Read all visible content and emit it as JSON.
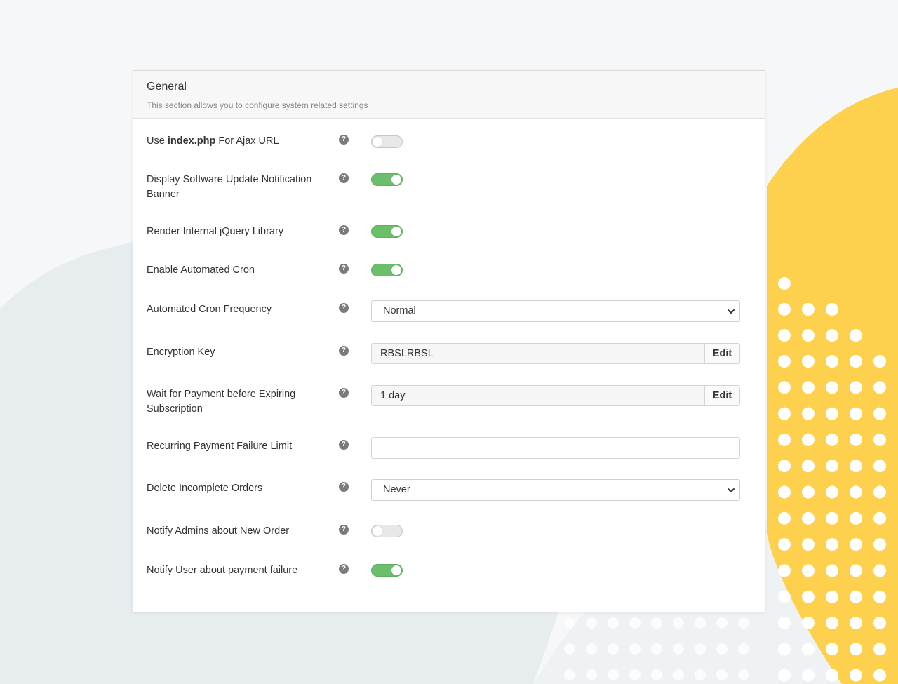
{
  "section": {
    "title": "General",
    "description": "This section allows you to configure system related settings"
  },
  "settings": [
    {
      "label_prefix": "Use ",
      "label_bold": "index.php",
      "label_suffix": " For Ajax URL",
      "control": "toggle",
      "enabled": false
    },
    {
      "label": "Display Software Update Notification Banner",
      "control": "toggle",
      "enabled": true
    },
    {
      "label": "Render Internal jQuery Library",
      "control": "toggle",
      "enabled": true
    },
    {
      "label": "Enable Automated Cron",
      "control": "toggle",
      "enabled": true
    },
    {
      "label": "Automated Cron Frequency",
      "control": "select",
      "value": "Normal"
    },
    {
      "label": "Encryption Key",
      "control": "input-with-button",
      "value": "RBSLRBSL",
      "button_label": "Edit"
    },
    {
      "label": "Wait for Payment before Expiring Subscription",
      "control": "input-with-button",
      "value": "1 day",
      "button_label": "Edit"
    },
    {
      "label": "Recurring Payment Failure Limit",
      "control": "text-input",
      "value": ""
    },
    {
      "label": "Delete Incomplete Orders",
      "control": "select",
      "value": "Never"
    },
    {
      "label": "Notify Admins about New Order",
      "control": "toggle",
      "enabled": false
    },
    {
      "label": "Notify User about payment failure",
      "control": "toggle",
      "enabled": true
    }
  ],
  "help_icon_glyph": "?",
  "colors": {
    "toggle_on": "#6cbf6a",
    "toggle_off": "#e8e8e8",
    "accent_shape": "#fdd04e"
  },
  "icons": {
    "help": "question-circle-icon",
    "select": "chevron-down-icon"
  }
}
